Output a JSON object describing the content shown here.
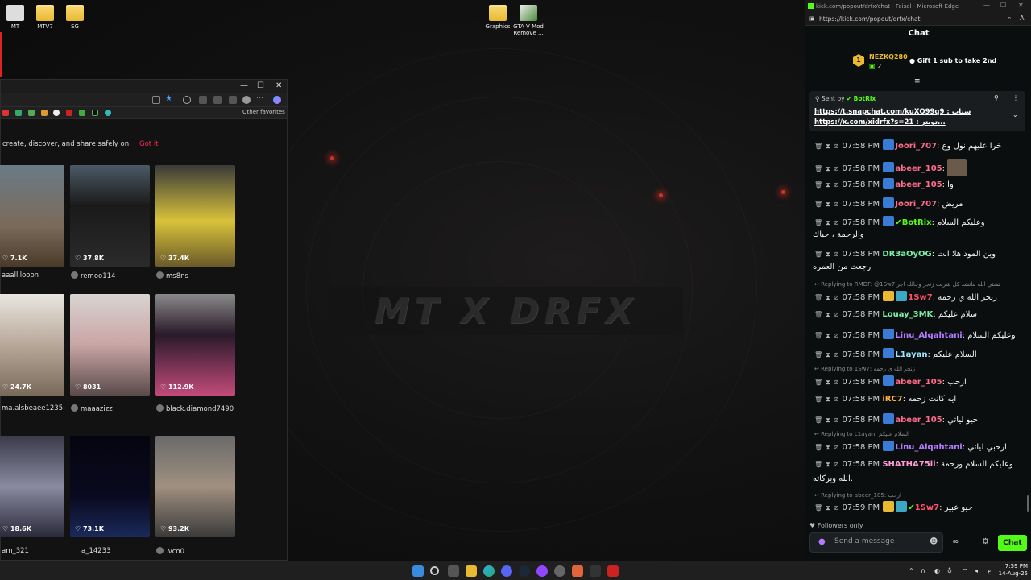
{
  "desktop": {
    "icons": [
      {
        "label": "MT"
      },
      {
        "label": "MTV7"
      },
      {
        "label": "SG"
      },
      {
        "label": "Graphics"
      },
      {
        "label": "GTA V Mod Remove ..."
      }
    ],
    "watermark": "MT X DRFX"
  },
  "tiktok": {
    "banner_text": "create, discover, and share safely on",
    "banner_action": "Got it",
    "other_favorites": "Other favorites",
    "videos": [
      {
        "likes": "7.1K",
        "user": "aaallllooon"
      },
      {
        "likes": "37.8K",
        "user": "remoo114"
      },
      {
        "likes": "37.4K",
        "user": "ms8ns"
      },
      {
        "likes": "24.7K",
        "user": "ma.alsbeaee1235"
      },
      {
        "likes": "8031",
        "user": "maaazizz"
      },
      {
        "likes": "112.9K",
        "user": "black.diamond7490"
      },
      {
        "likes": "18.6K",
        "user": "am_321"
      },
      {
        "likes": "73.1K",
        "user": "a_14233"
      },
      {
        "likes": "93.2K",
        "user": ".vco0"
      }
    ]
  },
  "kick": {
    "window_title": "kick.com/popout/drfx/chat - Faisal - Microsoft Edge",
    "url": "https://kick.com/popout/drfx/chat",
    "chat_title": "Chat",
    "leaderboard": {
      "rank": "1",
      "name": "NEZKQ280",
      "count": "2",
      "gift_text": "Gift 1 sub to take 2nd"
    },
    "pinned": {
      "sent_by_label": "Sent by",
      "sent_by": "BotRix",
      "line1": "https://t.snapchat.com/kuXQ99q9 : سناب",
      "line2": "https://x.com/xidrfx?s=21 : تويتر..."
    },
    "messages": [
      {
        "time": "07:58 PM",
        "user": "Joori_707",
        "text": "خرا عليهم نول وع",
        "color": "#ff6b8a"
      },
      {
        "time": "07:58 PM",
        "user": "abeer_105",
        "text": "",
        "color": "#ff6b8a"
      },
      {
        "time": "07:58 PM",
        "user": "abeer_105",
        "text": "وا",
        "color": "#ff6b8a"
      },
      {
        "time": "07:58 PM",
        "user": "Joori_707",
        "text": "مريض",
        "color": "#ff6b8a"
      },
      {
        "time": "07:58 PM",
        "user": "BotRix",
        "text": "وعليكم السلام",
        "text2": "والرحمة ، حياك",
        "color": "#53fc18"
      },
      {
        "time": "07:58 PM",
        "user": "DR3aOyOG",
        "text": "وين المود هلا انت",
        "text2": "رجعت من العمره",
        "color": "#7cf0a9"
      },
      {
        "time": "07:58 PM",
        "user": "1Sw7",
        "text": "زنجر الله ي رحمه",
        "color": "#ff4f6a",
        "reply": "Replying to RMDF: @1Sw7 تشتي الله ماتشد كل شريت زنجر وجالك اجر"
      },
      {
        "time": "07:58 PM",
        "user": "Louay_3MK",
        "text": "سلام عليكم",
        "color": "#7cf0a9"
      },
      {
        "time": "07:58 PM",
        "user": "Linu_Alqahtani",
        "text": "وعليكم السلام",
        "color": "#b57bff"
      },
      {
        "time": "07:58 PM",
        "user": "L1ayan",
        "text": "السلام عليكم",
        "color": "#9be7ff"
      },
      {
        "time": "07:58 PM",
        "user": "abeer_105",
        "text": "ارحب",
        "color": "#ff6b8a",
        "reply": "Replying to 1Sw7: زنجر الله ي رحمه"
      },
      {
        "time": "07:58 PM",
        "user": "iRC7",
        "text": "ايه كانت زحمه",
        "color": "#ffb347"
      },
      {
        "time": "07:58 PM",
        "user": "abeer_105",
        "text": "حيو لياتي",
        "color": "#ff6b8a"
      },
      {
        "time": "07:58 PM",
        "user": "Linu_Alqahtani",
        "text": "ارحبي لياتي",
        "color": "#b57bff",
        "reply": "Replying to L1ayan: السلام عليكم"
      },
      {
        "time": "07:58 PM",
        "user": "SHATHA75ii",
        "text": "وعليكم السلام ورحمة",
        "text2": "الله وبركاته.",
        "color": "#ff9ad5"
      },
      {
        "time": "07:59 PM",
        "user": "1Sw7",
        "text": "حيو عبير",
        "color": "#ff4f6a",
        "reply": "Replying to abeer_105: ارحب"
      }
    ],
    "followers_only": "Followers only",
    "send_placeholder": "Send a message",
    "chat_button": "Chat"
  },
  "taskbar": {
    "time": "7:59 PM",
    "date": "14-Aug-25"
  }
}
